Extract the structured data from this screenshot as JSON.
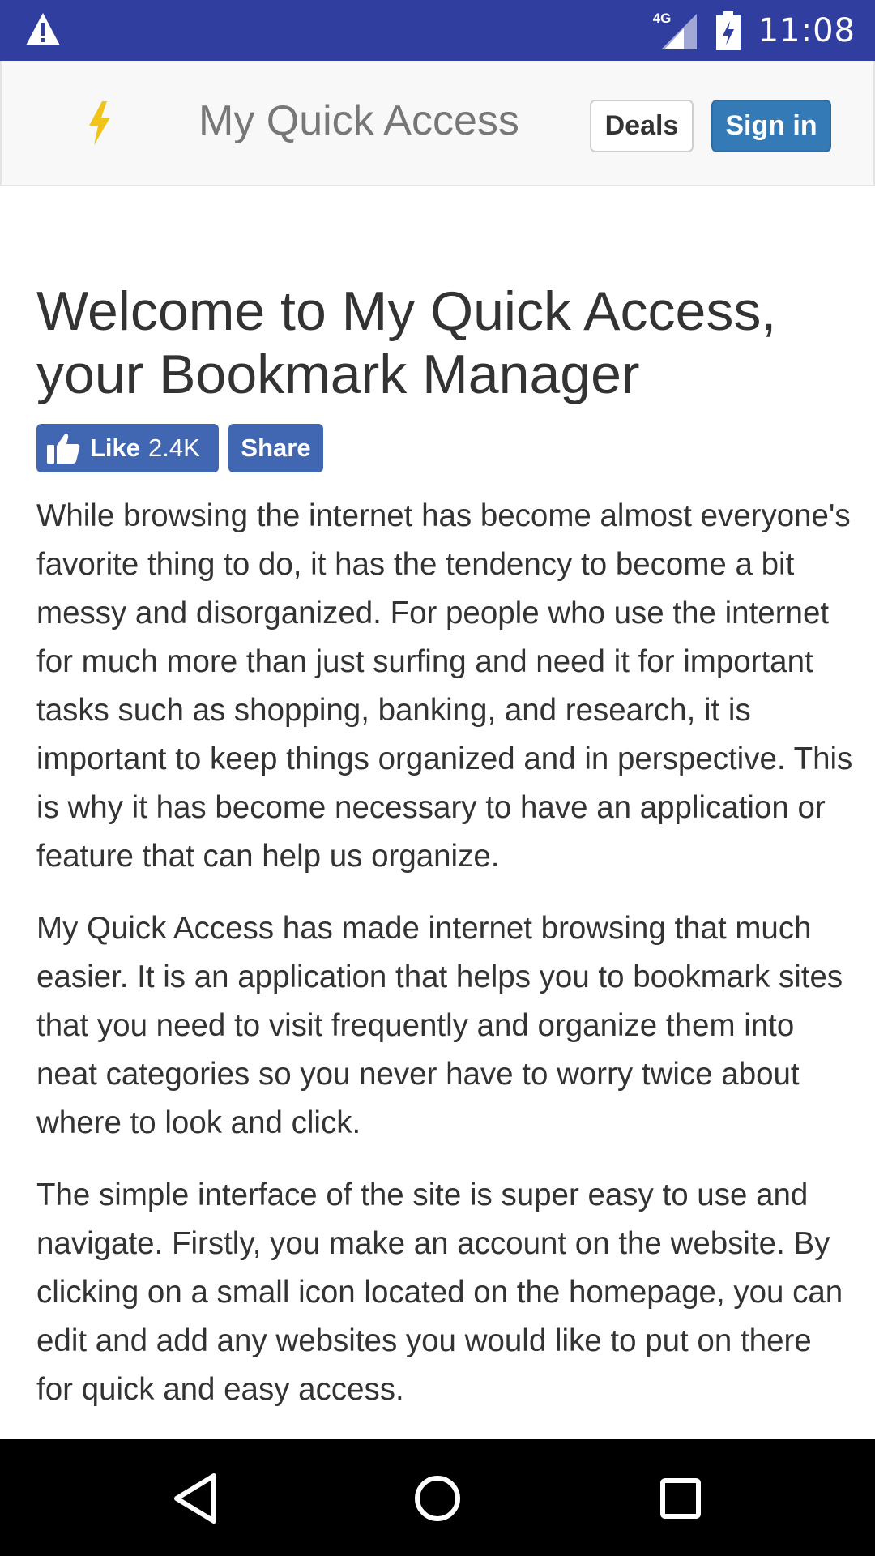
{
  "status_bar": {
    "network_label": "4G",
    "time": "11:08",
    "icons": [
      "warning-icon",
      "signal-icon",
      "battery-icon"
    ]
  },
  "header": {
    "brand_icon": "bolt-icon",
    "brand_title": "My Quick Access",
    "deals_label": "Deals",
    "signin_label": "Sign in"
  },
  "main": {
    "title": "Welcome to My Quick Access, your Bookmark Manager",
    "like_label": "Like",
    "like_count": "2.4K",
    "share_label": "Share",
    "paragraphs": [
      "While browsing the internet has become almost everyone's favorite thing to do, it has the tendency to become a bit messy and disorganized. For people who use the internet for much more than just surfing and need it for important tasks such as shopping, banking, and research, it is important to keep things organized and in perspective. This is why it has become necessary to have an application or feature that can help us organize.",
      "My Quick Access has made internet browsing that much easier. It is an application that helps you to bookmark sites that you need to visit frequently and organize them into neat categories so you never have to worry twice about where to look and click.",
      "The simple interface of the site is super easy to use and navigate. Firstly, you make an account on the website. By clicking on a small icon located on the homepage, you can edit and add any websites you would like to put on there for quick and easy access."
    ]
  },
  "nav_bar": {
    "icons": [
      "back-icon",
      "home-icon",
      "recents-icon"
    ]
  },
  "colors": {
    "status_bar": "#303f9f",
    "header_bg": "#f8f8f8",
    "brand_icon": "#f0c419",
    "signin_button": "#337ab7",
    "facebook_blue": "#4267b2",
    "text": "#333333"
  }
}
